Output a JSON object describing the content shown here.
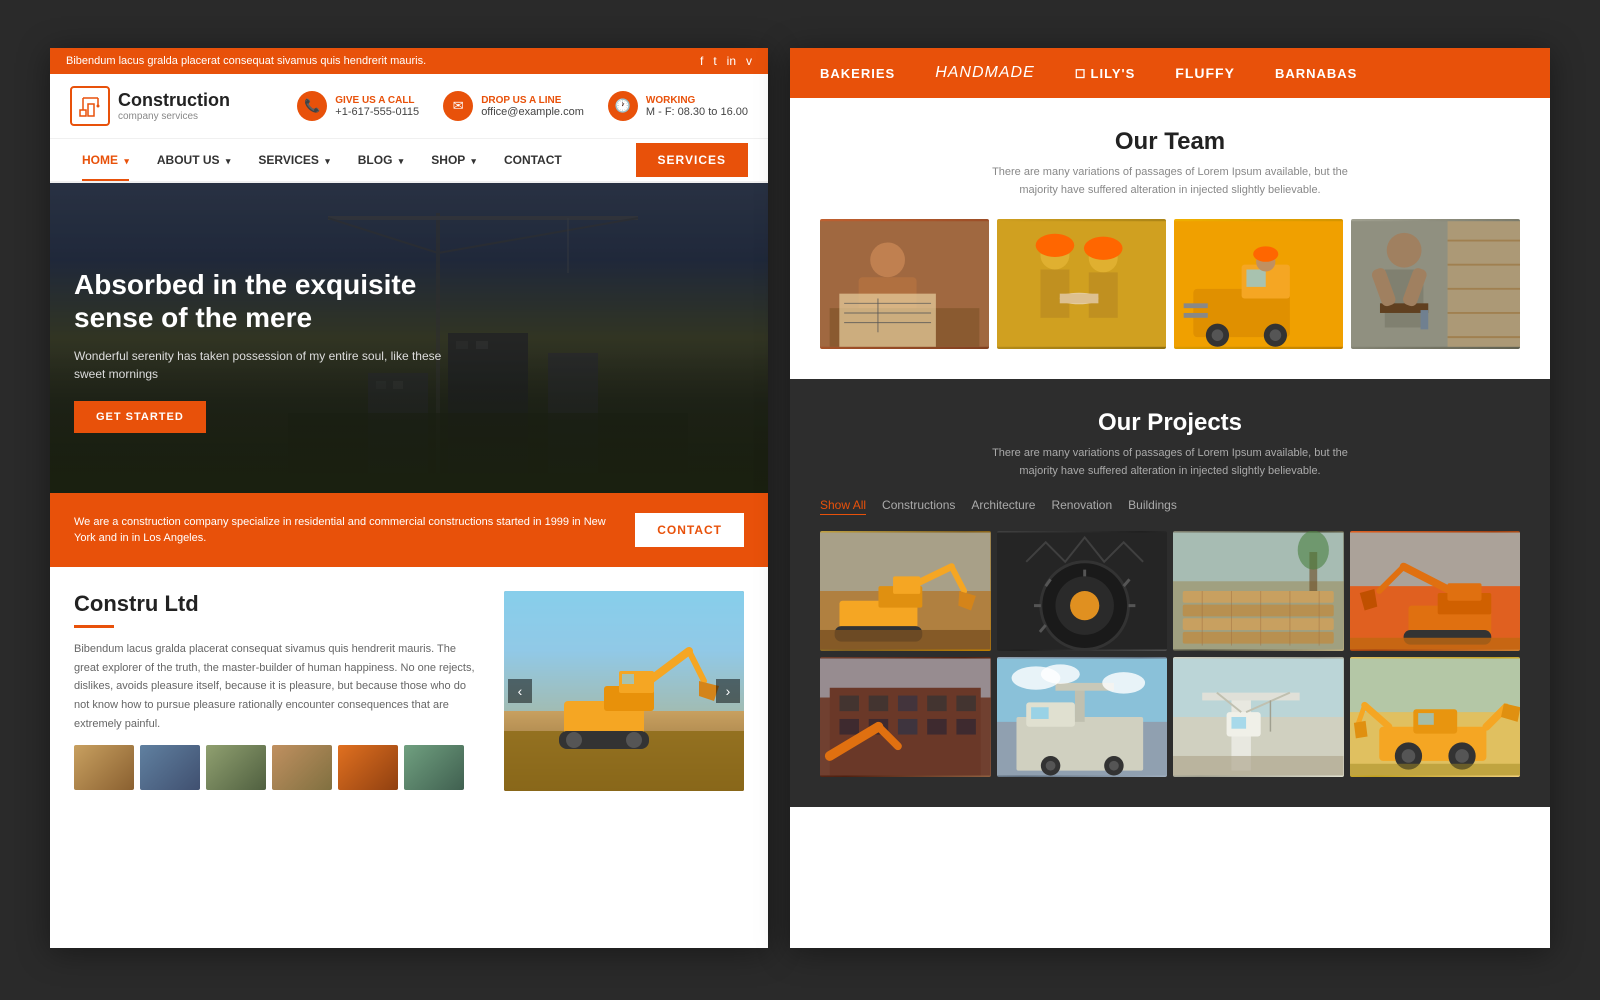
{
  "leftPanel": {
    "topBar": {
      "message": "Bibendum lacus gralda placerat consequat sivamus quis hendrerit mauris.",
      "social": [
        "f",
        "t",
        "in",
        "v"
      ]
    },
    "header": {
      "logoTitle": "Construction",
      "logoSub": "company services",
      "contacts": [
        {
          "icon": "📞",
          "label": "Give us a call",
          "value": "+1-617-555-0115"
        },
        {
          "icon": "✉",
          "label": "Drop us a line",
          "value": "office@example.com"
        },
        {
          "icon": "🕐",
          "label": "Working",
          "value": "M - F: 08.30 to 16.00"
        }
      ]
    },
    "nav": {
      "items": [
        {
          "label": "HOME",
          "active": true,
          "hasArrow": true
        },
        {
          "label": "ABOUT US",
          "active": false,
          "hasArrow": true
        },
        {
          "label": "SERVICES",
          "active": false,
          "hasArrow": true
        },
        {
          "label": "BLOG",
          "active": false,
          "hasArrow": true
        },
        {
          "label": "SHOP",
          "active": false,
          "hasArrow": true
        },
        {
          "label": "CONTACT",
          "active": false,
          "hasArrow": false
        }
      ],
      "ctaLabel": "SERVICES"
    },
    "hero": {
      "title": "Absorbed in the exquisite sense of the mere",
      "subtitle": "Wonderful serenity has taken possession of my entire soul, like these sweet mornings",
      "btnLabel": "GET STARTED"
    },
    "infoBar": {
      "text": "We are a construction company specialize in residential and commercial constructions  started in 1999 in New York and in in Los Angeles.",
      "btnLabel": "CONTACT"
    },
    "about": {
      "title": "Constru Ltd",
      "description": "Bibendum lacus gralda placerat consequat sivamus quis hendrerit mauris. The great explorer of the truth, the master-builder of human happiness. No one rejects, dislikes, avoids pleasure itself, because it is pleasure, but because those who do not know how to pursue pleasure rationally encounter consequences that are extremely painful."
    }
  },
  "rightPanel": {
    "categories": [
      {
        "label": "BAKERIES",
        "style": "normal"
      },
      {
        "label": "Handmade",
        "style": "italic"
      },
      {
        "label": "❑ LILY'S",
        "style": "normal"
      },
      {
        "label": "FLUFFY",
        "style": "normal"
      },
      {
        "label": "BARNABAS",
        "style": "normal"
      }
    ],
    "team": {
      "title": "Our Team",
      "description": "There are many variations of passages of Lorem Ipsum available, but the majority have suffered alteration in injected slightly believable."
    },
    "projects": {
      "title": "Our Projects",
      "description": "There are many variations of passages of Lorem Ipsum available, but the majority have suffered alteration in injected slightly believable.",
      "filters": [
        "Show All",
        "Constructions",
        "Architecture",
        "Renovation",
        "Buildings"
      ]
    }
  }
}
